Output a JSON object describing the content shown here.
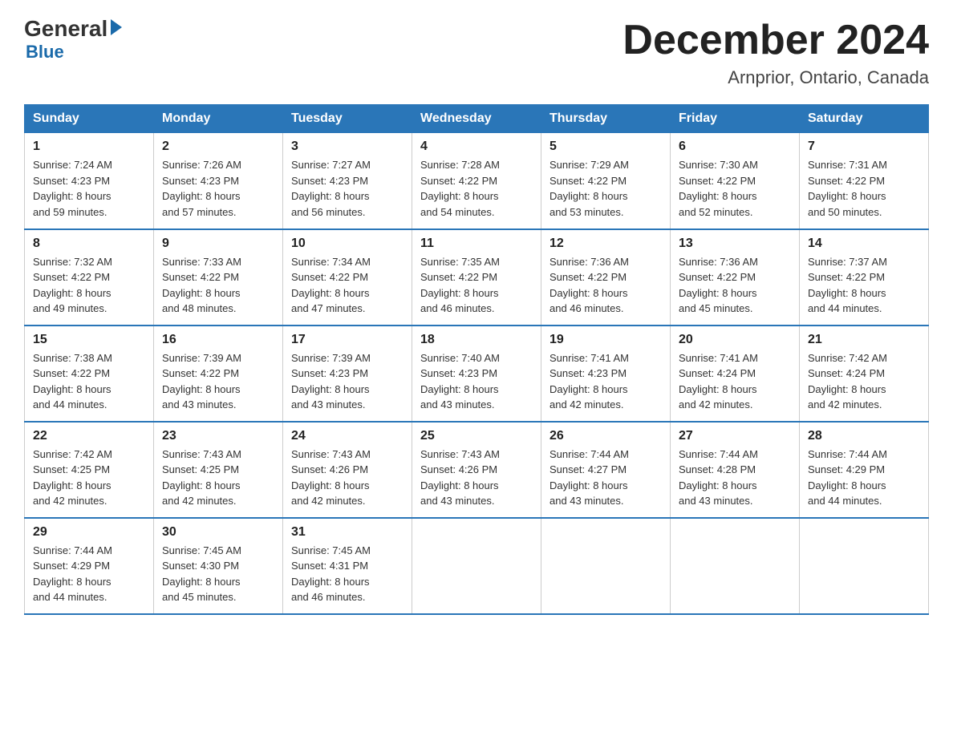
{
  "header": {
    "logo_general": "General",
    "logo_blue": "Blue",
    "title": "December 2024",
    "subtitle": "Arnprior, Ontario, Canada"
  },
  "days_of_week": [
    "Sunday",
    "Monday",
    "Tuesday",
    "Wednesday",
    "Thursday",
    "Friday",
    "Saturday"
  ],
  "weeks": [
    [
      {
        "day": "1",
        "sunrise": "7:24 AM",
        "sunset": "4:23 PM",
        "daylight": "8 hours and 59 minutes."
      },
      {
        "day": "2",
        "sunrise": "7:26 AM",
        "sunset": "4:23 PM",
        "daylight": "8 hours and 57 minutes."
      },
      {
        "day": "3",
        "sunrise": "7:27 AM",
        "sunset": "4:23 PM",
        "daylight": "8 hours and 56 minutes."
      },
      {
        "day": "4",
        "sunrise": "7:28 AM",
        "sunset": "4:22 PM",
        "daylight": "8 hours and 54 minutes."
      },
      {
        "day": "5",
        "sunrise": "7:29 AM",
        "sunset": "4:22 PM",
        "daylight": "8 hours and 53 minutes."
      },
      {
        "day": "6",
        "sunrise": "7:30 AM",
        "sunset": "4:22 PM",
        "daylight": "8 hours and 52 minutes."
      },
      {
        "day": "7",
        "sunrise": "7:31 AM",
        "sunset": "4:22 PM",
        "daylight": "8 hours and 50 minutes."
      }
    ],
    [
      {
        "day": "8",
        "sunrise": "7:32 AM",
        "sunset": "4:22 PM",
        "daylight": "8 hours and 49 minutes."
      },
      {
        "day": "9",
        "sunrise": "7:33 AM",
        "sunset": "4:22 PM",
        "daylight": "8 hours and 48 minutes."
      },
      {
        "day": "10",
        "sunrise": "7:34 AM",
        "sunset": "4:22 PM",
        "daylight": "8 hours and 47 minutes."
      },
      {
        "day": "11",
        "sunrise": "7:35 AM",
        "sunset": "4:22 PM",
        "daylight": "8 hours and 46 minutes."
      },
      {
        "day": "12",
        "sunrise": "7:36 AM",
        "sunset": "4:22 PM",
        "daylight": "8 hours and 46 minutes."
      },
      {
        "day": "13",
        "sunrise": "7:36 AM",
        "sunset": "4:22 PM",
        "daylight": "8 hours and 45 minutes."
      },
      {
        "day": "14",
        "sunrise": "7:37 AM",
        "sunset": "4:22 PM",
        "daylight": "8 hours and 44 minutes."
      }
    ],
    [
      {
        "day": "15",
        "sunrise": "7:38 AM",
        "sunset": "4:22 PM",
        "daylight": "8 hours and 44 minutes."
      },
      {
        "day": "16",
        "sunrise": "7:39 AM",
        "sunset": "4:22 PM",
        "daylight": "8 hours and 43 minutes."
      },
      {
        "day": "17",
        "sunrise": "7:39 AM",
        "sunset": "4:23 PM",
        "daylight": "8 hours and 43 minutes."
      },
      {
        "day": "18",
        "sunrise": "7:40 AM",
        "sunset": "4:23 PM",
        "daylight": "8 hours and 43 minutes."
      },
      {
        "day": "19",
        "sunrise": "7:41 AM",
        "sunset": "4:23 PM",
        "daylight": "8 hours and 42 minutes."
      },
      {
        "day": "20",
        "sunrise": "7:41 AM",
        "sunset": "4:24 PM",
        "daylight": "8 hours and 42 minutes."
      },
      {
        "day": "21",
        "sunrise": "7:42 AM",
        "sunset": "4:24 PM",
        "daylight": "8 hours and 42 minutes."
      }
    ],
    [
      {
        "day": "22",
        "sunrise": "7:42 AM",
        "sunset": "4:25 PM",
        "daylight": "8 hours and 42 minutes."
      },
      {
        "day": "23",
        "sunrise": "7:43 AM",
        "sunset": "4:25 PM",
        "daylight": "8 hours and 42 minutes."
      },
      {
        "day": "24",
        "sunrise": "7:43 AM",
        "sunset": "4:26 PM",
        "daylight": "8 hours and 42 minutes."
      },
      {
        "day": "25",
        "sunrise": "7:43 AM",
        "sunset": "4:26 PM",
        "daylight": "8 hours and 43 minutes."
      },
      {
        "day": "26",
        "sunrise": "7:44 AM",
        "sunset": "4:27 PM",
        "daylight": "8 hours and 43 minutes."
      },
      {
        "day": "27",
        "sunrise": "7:44 AM",
        "sunset": "4:28 PM",
        "daylight": "8 hours and 43 minutes."
      },
      {
        "day": "28",
        "sunrise": "7:44 AM",
        "sunset": "4:29 PM",
        "daylight": "8 hours and 44 minutes."
      }
    ],
    [
      {
        "day": "29",
        "sunrise": "7:44 AM",
        "sunset": "4:29 PM",
        "daylight": "8 hours and 44 minutes."
      },
      {
        "day": "30",
        "sunrise": "7:45 AM",
        "sunset": "4:30 PM",
        "daylight": "8 hours and 45 minutes."
      },
      {
        "day": "31",
        "sunrise": "7:45 AM",
        "sunset": "4:31 PM",
        "daylight": "8 hours and 46 minutes."
      },
      null,
      null,
      null,
      null
    ]
  ],
  "labels": {
    "sunrise": "Sunrise:",
    "sunset": "Sunset:",
    "daylight": "Daylight:"
  }
}
